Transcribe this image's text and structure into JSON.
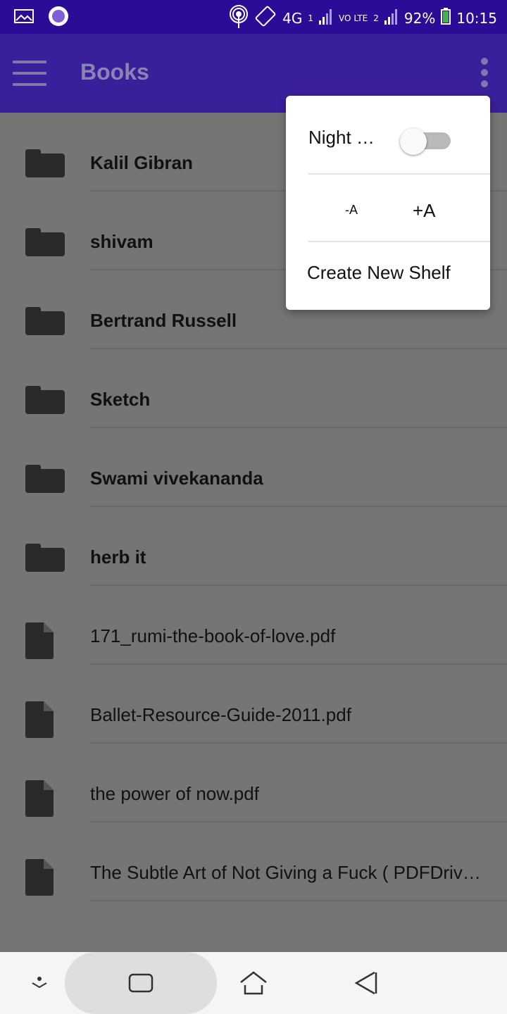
{
  "status_bar": {
    "network": "4G",
    "sim1": "1",
    "volte": "VO",
    "lte": "LTE",
    "sim2": "2",
    "battery": "92%",
    "time": "10:15",
    "icons": [
      "gallery-icon",
      "recording-icon",
      "hotspot-icon",
      "rotate-icon",
      "signal-icon",
      "battery-icon"
    ]
  },
  "app_bar": {
    "title": "Books",
    "icons": [
      "menu-icon",
      "more-vert-icon"
    ]
  },
  "list": {
    "items": [
      {
        "type": "folder",
        "label": "Kalil Gibran"
      },
      {
        "type": "folder",
        "label": "shivam"
      },
      {
        "type": "folder",
        "label": "Bertrand Russell"
      },
      {
        "type": "folder",
        "label": "Sketch"
      },
      {
        "type": "folder",
        "label": "Swami vivekananda"
      },
      {
        "type": "folder",
        "label": "herb it"
      },
      {
        "type": "file",
        "label": "171_rumi-the-book-of-love.pdf"
      },
      {
        "type": "file",
        "label": "Ballet-Resource-Guide-2011.pdf"
      },
      {
        "type": "file",
        "label": "the power of now.pdf"
      },
      {
        "type": "file",
        "label": "The Subtle Art of Not Giving a Fuck ( PDFDriv…"
      }
    ]
  },
  "menu": {
    "night_mode_label": "Night …",
    "night_mode_on": false,
    "font_decrease": "-A",
    "font_increase": "+A",
    "create_shelf": "Create New Shelf"
  },
  "nav_bar": {
    "icons": [
      "hide-keyboard-icon",
      "recents-icon",
      "home-icon",
      "back-icon"
    ]
  },
  "colors": {
    "status_bar": "#2a0c96",
    "app_bar_dimmed": "#3a1f9b",
    "scrim_background": "#757575",
    "menu_background": "#ffffff"
  }
}
